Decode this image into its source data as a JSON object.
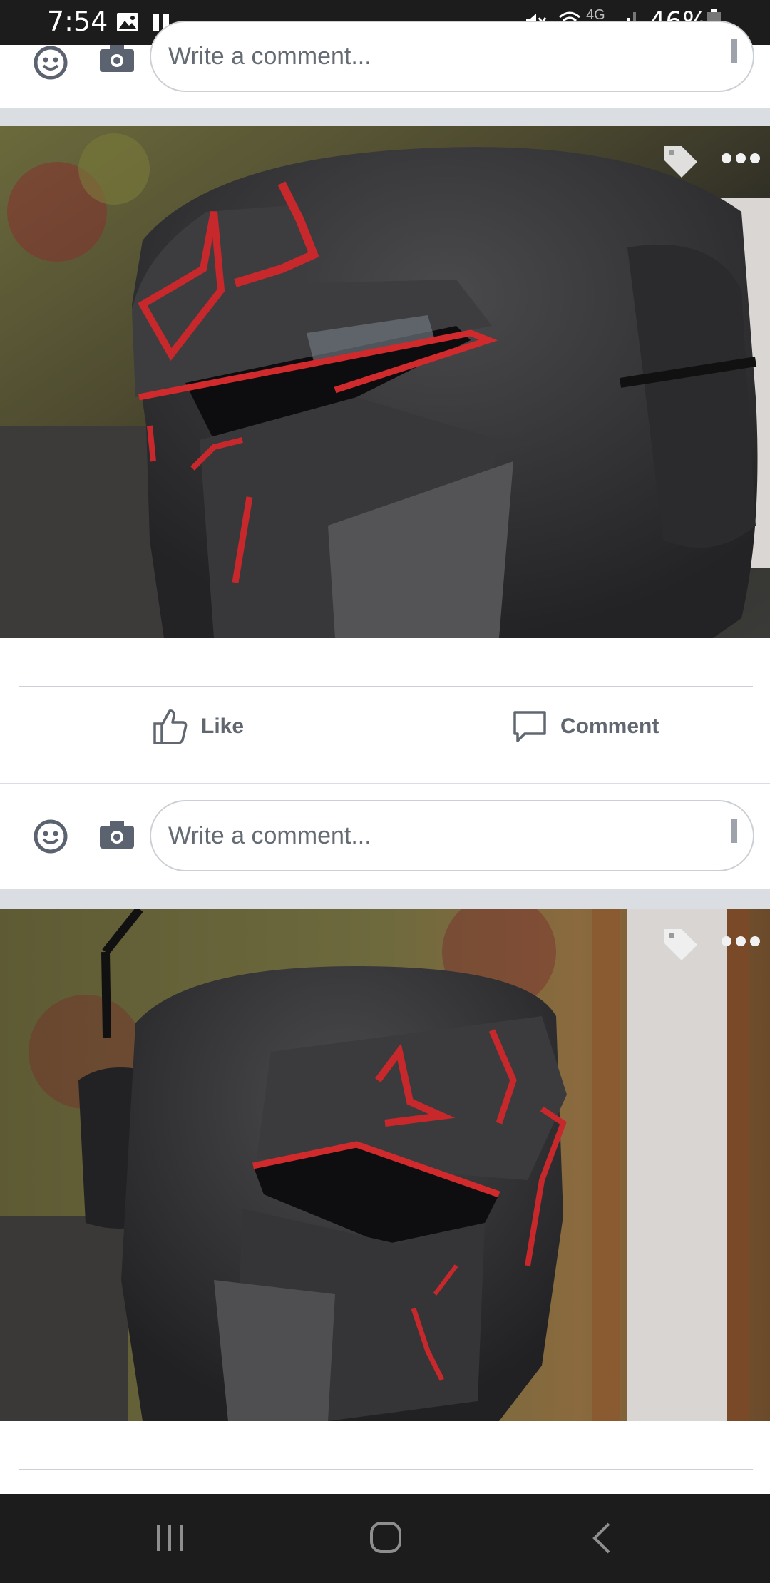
{
  "status_bar": {
    "time": "7:54",
    "battery_percent": "46%",
    "network_label": "4G",
    "icons": [
      "gallery-icon",
      "pause-icon",
      "mute-icon",
      "wifi-call-icon",
      "signal-icon",
      "battery-icon"
    ]
  },
  "comment_placeholder": "Write a comment...",
  "actions": {
    "like_label": "Like",
    "comment_label": "Comment"
  },
  "photos": [
    {
      "subject": "black-and-red-helmet-side"
    },
    {
      "subject": "black-and-red-helmet-front"
    }
  ],
  "colors": {
    "text_secondary": "#606770",
    "divider": "#ccd0d5",
    "bar_background": "#1c1c1c"
  }
}
